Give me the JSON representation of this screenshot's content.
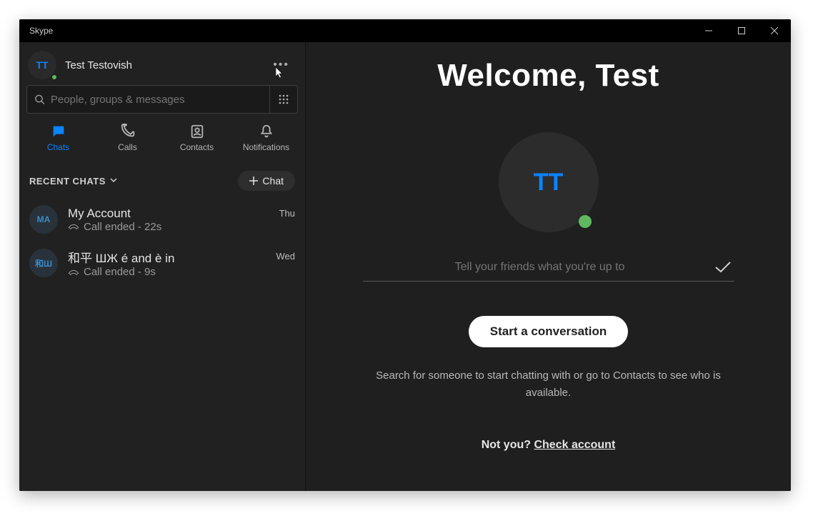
{
  "titlebar": {
    "title": "Skype"
  },
  "profile": {
    "initials": "TT",
    "name": "Test Testovish"
  },
  "search": {
    "placeholder": "People, groups & messages"
  },
  "tabs": {
    "chats": "Chats",
    "calls": "Calls",
    "contacts": "Contacts",
    "notifications": "Notifications"
  },
  "recent": {
    "header": "RECENT CHATS",
    "chat_button": "Chat",
    "items": [
      {
        "avatar": "MA",
        "title": "My Account",
        "sub": "Call ended - 22s",
        "time": "Thu"
      },
      {
        "avatar": "和Ш",
        "title": "和平 ШЖ é and è in",
        "sub": "Call ended - 9s",
        "time": "Wed"
      }
    ]
  },
  "main": {
    "welcome": "Welcome, Test",
    "avatar_initials": "TT",
    "status_placeholder": "Tell your friends what you're up to",
    "start_button": "Start a conversation",
    "helper_text": "Search for someone to start chatting with or go to Contacts to see who is available.",
    "not_you": "Not you? ",
    "check_account": "Check account"
  }
}
